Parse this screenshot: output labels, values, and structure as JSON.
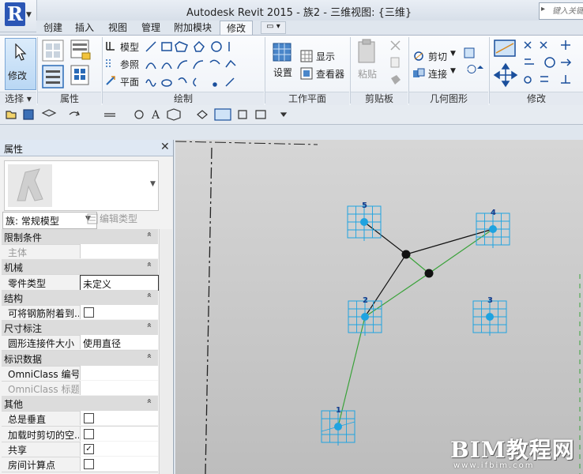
{
  "title_bar": {
    "app_title": "Autodesk Revit 2015  -    族2 - 三维视图: {三维}",
    "search_placeholder": "键入关键",
    "app_button_label": "R"
  },
  "ribbon_tabs": [
    {
      "label": "创建",
      "active": false
    },
    {
      "label": "插入",
      "active": false
    },
    {
      "label": "视图",
      "active": false
    },
    {
      "label": "管理",
      "active": false
    },
    {
      "label": "附加模块",
      "active": false
    },
    {
      "label": "修改",
      "active": true
    }
  ],
  "ribbon": {
    "modify_button": "修改",
    "select_panel": "选择 ▾",
    "properties_panel": "属性",
    "draw": {
      "model": "模型",
      "reference": "参照",
      "plane": "平面",
      "panel": "绘制"
    },
    "work_plane": {
      "set": "设置",
      "show": "显示",
      "viewer": "查看器",
      "panel": "工作平面"
    },
    "clipboard": {
      "paste": "粘贴",
      "panel": "剪贴板"
    },
    "geometry": {
      "cut": "剪切",
      "join": "连接",
      "panel": "几何图形"
    },
    "modify_panel": "修改"
  },
  "properties": {
    "header": "属性",
    "family_type": "族: 常规模型",
    "edit_type": "编辑类型",
    "sections": [
      {
        "label": "限制条件",
        "rows": [
          {
            "name": "主体",
            "value": "",
            "dim": true,
            "type": "text"
          }
        ]
      },
      {
        "label": "机械",
        "rows": [
          {
            "name": "零件类型",
            "value": "未定义",
            "dim": false,
            "type": "text"
          }
        ]
      },
      {
        "label": "结构",
        "rows": [
          {
            "name": "可将钢筋附着到...",
            "value": false,
            "dim": false,
            "type": "check"
          }
        ]
      },
      {
        "label": "尺寸标注",
        "rows": [
          {
            "name": "圆形连接件大小",
            "value": "使用直径",
            "dim": false,
            "type": "text"
          }
        ]
      },
      {
        "label": "标识数据",
        "rows": [
          {
            "name": "OmniClass 编号",
            "value": "",
            "dim": false,
            "type": "text"
          },
          {
            "name": "OmniClass 标题",
            "value": "",
            "dim": true,
            "type": "text"
          }
        ]
      },
      {
        "label": "其他",
        "rows": [
          {
            "name": "总是垂直",
            "value": false,
            "dim": false,
            "type": "check"
          },
          {
            "name": "加载时剪切的空...",
            "value": false,
            "dim": false,
            "type": "check"
          },
          {
            "name": "共享",
            "value": true,
            "dim": false,
            "type": "check"
          },
          {
            "name": "房间计算点",
            "value": false,
            "dim": false,
            "type": "check"
          }
        ]
      }
    ]
  },
  "viewport": {
    "points": [
      {
        "label": "1"
      },
      {
        "label": "2"
      },
      {
        "label": "3"
      },
      {
        "label": "4"
      },
      {
        "label": "5"
      }
    ]
  },
  "watermark": {
    "main": "BIM教程网",
    "url": "www.ifbim.com"
  },
  "colors": {
    "accent_blue": "#1fa3e0",
    "green_line": "#3aa23a",
    "black_line": "#111111"
  }
}
